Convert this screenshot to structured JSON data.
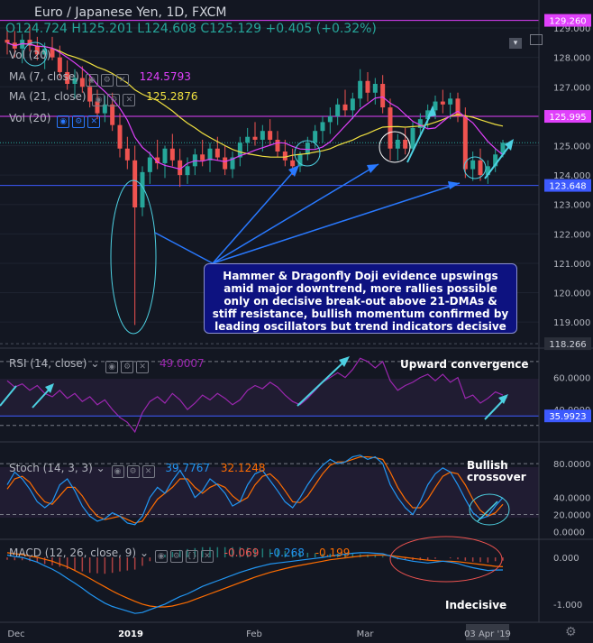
{
  "header": {
    "symbol_line": "Euro / Japanese Yen, 1D, FXCM",
    "ohlc_line": "O124.724  H125.201  L124.608  C125.129  +0.405 (+0.32%)"
  },
  "indicators": {
    "vol_top": "Vol (20)",
    "ma7_label": "MA (7, close)",
    "ma7_value": "124.5793",
    "ma21_label": "MA (21, close)",
    "ma21_value": "125.2876",
    "vol_label": "Vol (20)",
    "rsi_label": "RSI (14, close)",
    "rsi_value": "49.0007",
    "stoch_label": "Stoch (14, 3, 3)",
    "stoch_k": "39.7767",
    "stoch_d": "32.1248",
    "macd_label": "MACD (12, 26, close, 9)",
    "macd_hist": "-0.069",
    "macd_line": "-0.268",
    "macd_signal": "-0.199"
  },
  "annotations": {
    "note": "Hammer & Dragonfly Doji evidence upswings amid major downtrend, more rallies possible only on decisive break-out above 21-DMAs & stiff resistance, bullish momentum confirmed by leading oscillators but trend indicators decisive",
    "upward_convergence": "Upward convergence",
    "bullish_crossover": "Bullish crossover",
    "indecisive": "Indecisive"
  },
  "colors": {
    "background": "#131722",
    "up": "#26a69a",
    "down": "#ef5350",
    "ma7": "#e040fb",
    "ma21": "#f0e040",
    "level_line": "#e040fb",
    "support": "#3d5afe",
    "arrow": "#2979ff",
    "cyan": "#4dd0e1",
    "note_bg": "#0d1280"
  },
  "chart_data": [
    {
      "type": "candlestick",
      "title": "Euro / Japanese Yen, 1D, FXCM",
      "x_ticks": [
        "Dec",
        "2019",
        "Feb",
        "Mar",
        "03 Apr '19"
      ],
      "y_ticks": [
        "119.000",
        "120.000",
        "121.000",
        "122.000",
        "123.000",
        "124.000",
        "125.000",
        "126.000",
        "127.000",
        "128.000",
        "129.000"
      ],
      "ylim": [
        118.3,
        129.4
      ],
      "horizontal_levels": [
        {
          "label": "129.260",
          "value": 129.26
        },
        {
          "label": "125.995",
          "value": 125.995
        },
        {
          "label": "123.648",
          "value": 123.648
        },
        {
          "label": "118.266",
          "value": 118.266
        }
      ],
      "ohlc": [
        [
          128.6,
          129.0,
          128.1,
          128.5
        ],
        [
          128.5,
          128.9,
          128.0,
          128.3
        ],
        [
          128.3,
          128.8,
          127.8,
          128.6
        ],
        [
          128.6,
          129.1,
          128.2,
          128.4
        ],
        [
          128.4,
          128.7,
          127.9,
          128.1
        ],
        [
          128.1,
          128.5,
          127.6,
          128.3
        ],
        [
          128.3,
          128.7,
          127.9,
          128.0
        ],
        [
          128.0,
          128.4,
          127.3,
          127.5
        ],
        [
          127.5,
          127.9,
          126.9,
          127.1
        ],
        [
          127.1,
          127.6,
          126.6,
          127.3
        ],
        [
          127.3,
          127.7,
          126.8,
          127.0
        ],
        [
          127.0,
          127.4,
          126.3,
          126.5
        ],
        [
          126.5,
          126.9,
          125.9,
          126.1
        ],
        [
          126.1,
          126.7,
          125.8,
          126.4
        ],
        [
          126.4,
          126.8,
          125.5,
          125.7
        ],
        [
          125.7,
          126.1,
          124.6,
          124.9
        ],
        [
          124.9,
          125.3,
          124.2,
          124.5
        ],
        [
          124.5,
          125.0,
          118.9,
          122.9
        ],
        [
          122.9,
          124.3,
          122.6,
          124.1
        ],
        [
          124.1,
          124.8,
          123.7,
          124.6
        ],
        [
          124.6,
          125.2,
          124.2,
          124.4
        ],
        [
          124.4,
          125.0,
          123.9,
          124.9
        ],
        [
          124.9,
          125.4,
          124.3,
          124.5
        ],
        [
          124.5,
          124.9,
          123.6,
          124.0
        ],
        [
          124.0,
          124.6,
          123.7,
          124.3
        ],
        [
          124.3,
          124.9,
          124.0,
          124.7
        ],
        [
          124.7,
          125.2,
          124.3,
          124.5
        ],
        [
          124.5,
          125.1,
          124.1,
          124.9
        ],
        [
          124.9,
          125.3,
          124.5,
          124.6
        ],
        [
          124.6,
          125.0,
          124.0,
          124.2
        ],
        [
          124.2,
          124.8,
          123.9,
          124.6
        ],
        [
          124.6,
          125.3,
          124.3,
          125.1
        ],
        [
          125.1,
          125.6,
          124.8,
          125.3
        ],
        [
          125.3,
          125.8,
          125.0,
          125.2
        ],
        [
          125.2,
          125.7,
          124.8,
          125.5
        ],
        [
          125.5,
          125.9,
          125.0,
          125.2
        ],
        [
          125.2,
          125.5,
          124.6,
          124.8
        ],
        [
          124.8,
          125.2,
          124.3,
          124.5
        ],
        [
          124.5,
          124.9,
          124.0,
          124.3
        ],
        [
          124.3,
          124.8,
          124.1,
          124.7
        ],
        [
          124.7,
          125.3,
          124.5,
          125.1
        ],
        [
          125.1,
          125.7,
          124.9,
          125.5
        ],
        [
          125.5,
          126.0,
          125.1,
          125.8
        ],
        [
          125.8,
          126.3,
          125.4,
          126.0
        ],
        [
          126.0,
          126.6,
          125.7,
          126.4
        ],
        [
          126.4,
          126.9,
          126.0,
          126.2
        ],
        [
          126.2,
          126.8,
          125.9,
          126.6
        ],
        [
          126.6,
          127.6,
          126.3,
          127.2
        ],
        [
          127.2,
          127.5,
          126.5,
          126.8
        ],
        [
          126.8,
          127.3,
          126.4,
          127.1
        ],
        [
          127.1,
          127.4,
          126.1,
          126.3
        ],
        [
          126.3,
          126.6,
          124.5,
          124.9
        ],
        [
          124.9,
          125.4,
          124.5,
          125.2
        ],
        [
          125.2,
          125.6,
          124.7,
          124.9
        ],
        [
          124.9,
          125.8,
          124.8,
          125.6
        ],
        [
          125.6,
          126.1,
          125.3,
          125.9
        ],
        [
          125.9,
          126.4,
          125.6,
          126.2
        ],
        [
          126.2,
          126.7,
          125.9,
          126.5
        ],
        [
          126.5,
          126.9,
          126.1,
          126.4
        ],
        [
          126.4,
          126.8,
          125.9,
          126.6
        ],
        [
          126.6,
          126.8,
          125.8,
          126.0
        ],
        [
          126.0,
          126.3,
          123.9,
          124.2
        ],
        [
          124.2,
          124.8,
          123.8,
          124.5
        ],
        [
          124.5,
          124.9,
          123.8,
          124.0
        ],
        [
          124.0,
          124.5,
          123.7,
          124.3
        ],
        [
          124.3,
          124.9,
          124.1,
          124.7
        ],
        [
          124.7,
          125.2,
          124.6,
          125.1
        ]
      ],
      "series": [
        {
          "name": "MA (7, close)",
          "last_value": "124.5793"
        },
        {
          "name": "MA (21, close)",
          "last_value": "125.2876"
        }
      ]
    },
    {
      "type": "line",
      "title": "RSI (14, close)",
      "y_ticks": [
        "40.0000",
        "60.0000"
      ],
      "levels": [
        {
          "label": "35.9923",
          "value": 35.99
        }
      ],
      "ylim": [
        22,
        75
      ],
      "values": [
        58,
        54,
        56,
        52,
        55,
        50,
        48,
        52,
        47,
        50,
        45,
        48,
        43,
        46,
        40,
        35,
        32,
        26,
        38,
        45,
        48,
        44,
        50,
        46,
        40,
        44,
        49,
        46,
        50,
        47,
        43,
        46,
        52,
        55,
        53,
        57,
        54,
        49,
        45,
        43,
        47,
        52,
        57,
        60,
        63,
        60,
        65,
        72,
        70,
        66,
        70,
        58,
        52,
        55,
        57,
        60,
        62,
        58,
        62,
        57,
        60,
        47,
        49,
        44,
        47,
        51,
        49
      ]
    },
    {
      "type": "line",
      "title": "Stoch (14, 3, 3)",
      "y_ticks": [
        "0.0000",
        "20.0000",
        "40.0000",
        "80.0000"
      ],
      "ylim": [
        -5,
        95
      ],
      "series": [
        {
          "name": "%K",
          "last_value": "39.7767",
          "values": [
            55,
            70,
            62,
            50,
            35,
            28,
            35,
            55,
            62,
            48,
            30,
            18,
            12,
            15,
            22,
            18,
            10,
            8,
            18,
            40,
            52,
            45,
            60,
            72,
            58,
            40,
            48,
            62,
            55,
            45,
            30,
            35,
            55,
            68,
            72,
            60,
            48,
            35,
            28,
            40,
            55,
            68,
            78,
            85,
            80,
            82,
            88,
            90,
            85,
            88,
            80,
            55,
            40,
            28,
            20,
            35,
            55,
            68,
            75,
            70,
            55,
            38,
            22,
            15,
            18,
            30,
            40
          ]
        },
        {
          "name": "%D",
          "last_value": "32.1248",
          "values": [
            50,
            62,
            65,
            58,
            45,
            35,
            32,
            42,
            52,
            52,
            42,
            28,
            18,
            14,
            16,
            18,
            14,
            10,
            12,
            25,
            38,
            45,
            52,
            62,
            62,
            52,
            45,
            52,
            56,
            52,
            42,
            35,
            40,
            55,
            65,
            68,
            60,
            48,
            35,
            34,
            42,
            55,
            68,
            78,
            82,
            82,
            85,
            88,
            88,
            87,
            85,
            70,
            52,
            38,
            28,
            28,
            38,
            52,
            65,
            70,
            68,
            55,
            38,
            25,
            18,
            22,
            32
          ]
        }
      ]
    },
    {
      "type": "line",
      "title": "MACD (12, 26, close, 9)",
      "y_ticks": [
        "-1.000",
        "0.000"
      ],
      "ylim": [
        -1.35,
        0.35
      ],
      "series": [
        {
          "name": "MACD",
          "last_value": "-0.268",
          "values": [
            0.05,
            0.02,
            0.0,
            -0.05,
            -0.1,
            -0.18,
            -0.25,
            -0.34,
            -0.45,
            -0.55,
            -0.66,
            -0.78,
            -0.88,
            -0.98,
            -1.05,
            -1.1,
            -1.15,
            -1.2,
            -1.18,
            -1.12,
            -1.06,
            -1.0,
            -0.92,
            -0.84,
            -0.78,
            -0.7,
            -0.62,
            -0.56,
            -0.5,
            -0.44,
            -0.38,
            -0.32,
            -0.27,
            -0.22,
            -0.18,
            -0.14,
            -0.12,
            -0.1,
            -0.08,
            -0.06,
            -0.04,
            -0.02,
            0.0,
            0.03,
            0.05,
            0.07,
            0.09,
            0.1,
            0.1,
            0.09,
            0.08,
            0.03,
            -0.02,
            -0.05,
            -0.08,
            -0.1,
            -0.12,
            -0.1,
            -0.08,
            -0.1,
            -0.13,
            -0.18,
            -0.22,
            -0.25,
            -0.28,
            -0.27,
            -0.268
          ]
        },
        {
          "name": "Signal",
          "last_value": "-0.199",
          "values": [
            0.1,
            0.08,
            0.06,
            0.03,
            0.0,
            -0.04,
            -0.08,
            -0.14,
            -0.2,
            -0.28,
            -0.36,
            -0.45,
            -0.54,
            -0.63,
            -0.72,
            -0.8,
            -0.87,
            -0.94,
            -1.0,
            -1.04,
            -1.06,
            -1.06,
            -1.04,
            -1.0,
            -0.96,
            -0.9,
            -0.84,
            -0.78,
            -0.72,
            -0.66,
            -0.6,
            -0.54,
            -0.48,
            -0.42,
            -0.37,
            -0.32,
            -0.28,
            -0.24,
            -0.2,
            -0.17,
            -0.14,
            -0.11,
            -0.08,
            -0.05,
            -0.03,
            -0.01,
            0.01,
            0.03,
            0.04,
            0.05,
            0.05,
            0.04,
            0.02,
            0.0,
            -0.02,
            -0.04,
            -0.06,
            -0.07,
            -0.08,
            -0.08,
            -0.09,
            -0.11,
            -0.13,
            -0.15,
            -0.17,
            -0.19,
            -0.199
          ]
        },
        {
          "name": "Histogram",
          "last_value": "-0.069"
        }
      ]
    }
  ]
}
